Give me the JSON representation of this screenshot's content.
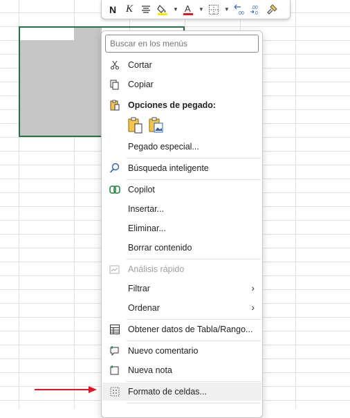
{
  "mini_toolbar": {
    "bold": "N",
    "italic": "K",
    "icons": [
      "bold-icon",
      "italic-icon",
      "align-icon",
      "fill-color-icon",
      "font-color-icon",
      "borders-icon",
      "decrease-decimal-icon",
      "increase-decimal-icon",
      "format-painter-icon"
    ],
    "font_color": "#e81123",
    "fill_color": "#ffe600"
  },
  "context_menu": {
    "search_placeholder": "Buscar en los menús",
    "items": {
      "cortar": "Cortar",
      "copiar": "Copiar",
      "opciones_pegado": "Opciones de pegado:",
      "pegado_especial": "Pegado especial...",
      "busqueda": "Búsqueda inteligente",
      "copilot": "Copilot",
      "insertar": "Insertar...",
      "eliminar": "Eliminar...",
      "borrar": "Borrar contenido",
      "analisis": "Análisis rápido",
      "filtrar": "Filtrar",
      "ordenar": "Ordenar",
      "obtener": "Obtener datos de Tabla/Rango...",
      "nuevo_comentario": "Nuevo comentario",
      "nueva_nota": "Nueva nota",
      "formato": "Formato de celdas..."
    }
  },
  "colors": {
    "selection_border": "#217346",
    "arrow": "#e81123"
  }
}
